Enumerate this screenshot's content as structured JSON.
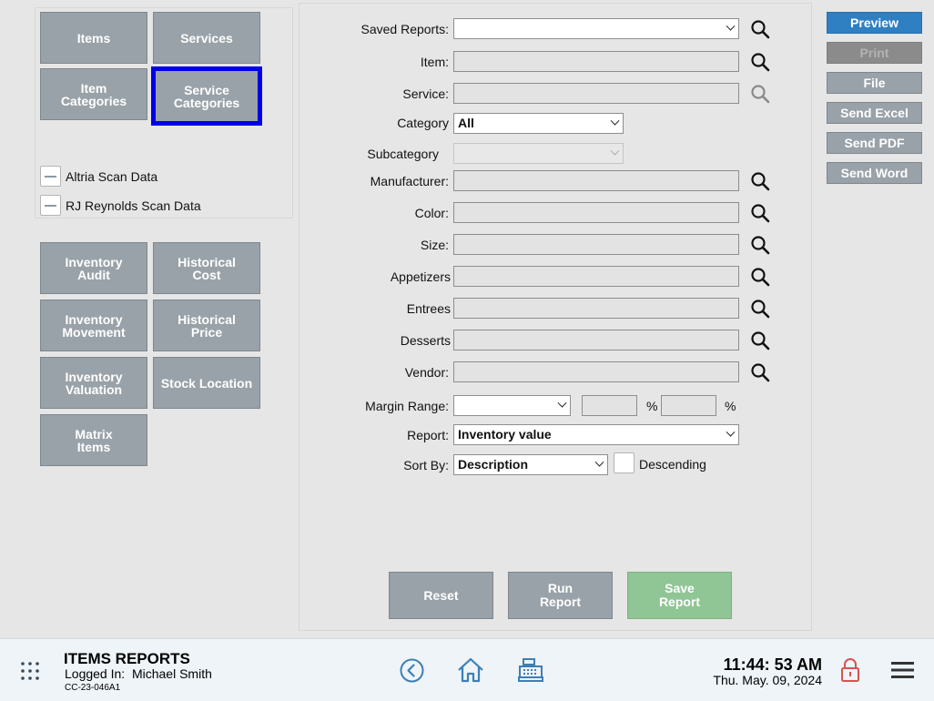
{
  "left_panel": {
    "top_tiles": [
      {
        "label": "Items"
      },
      {
        "label": "Services"
      },
      {
        "label": "Item\nCategories"
      },
      {
        "label": "Service\nCategories",
        "selected": true
      }
    ],
    "scan_options": [
      {
        "label": "Altria Scan Data",
        "checked": false
      },
      {
        "label": "RJ Reynolds Scan Data",
        "checked": false
      }
    ],
    "report_tiles": [
      {
        "label": "Inventory\nAudit"
      },
      {
        "label": "Historical\nCost"
      },
      {
        "label": "Inventory\nMovement"
      },
      {
        "label": "Historical\nPrice"
      },
      {
        "label": "Inventory\nValuation"
      },
      {
        "label": "Stock Location"
      },
      {
        "label": "Matrix\nItems"
      }
    ]
  },
  "form": {
    "saved_reports": {
      "label": "Saved Reports:",
      "value": ""
    },
    "item": {
      "label": "Item:",
      "value": ""
    },
    "service": {
      "label": "Service:",
      "value": ""
    },
    "category": {
      "label": "Category",
      "value": "All"
    },
    "subcategory": {
      "label": "Subcategory",
      "value": ""
    },
    "manufacturer": {
      "label": "Manufacturer:",
      "value": ""
    },
    "color": {
      "label": "Color:",
      "value": ""
    },
    "size": {
      "label": "Size:",
      "value": ""
    },
    "appetizers": {
      "label": "Appetizers",
      "value": ""
    },
    "entrees": {
      "label": "Entrees",
      "value": ""
    },
    "desserts": {
      "label": "Desserts",
      "value": ""
    },
    "vendor": {
      "label": "Vendor:",
      "value": ""
    },
    "margin_range": {
      "label": "Margin Range:",
      "value": "",
      "min": "",
      "max": "",
      "pct_symbol": "%"
    },
    "report": {
      "label": "Report:",
      "value": "Inventory value"
    },
    "sort_by": {
      "label": "Sort By:",
      "value": "Description"
    },
    "descending": {
      "label": "Descending",
      "checked": false
    },
    "buttons": {
      "reset": "Reset",
      "run": "Run\nReport",
      "save": "Save\nReport"
    }
  },
  "right_buttons": {
    "preview": "Preview",
    "print": "Print",
    "file": "File",
    "send_excel": "Send Excel",
    "send_pdf": "Send PDF",
    "send_word": "Send Word"
  },
  "footer": {
    "title": "ITEMS REPORTS",
    "logged_in_label": "Logged In:",
    "user": "Michael Smith",
    "device_code": "CC-23-046A1",
    "time": "11:44: 53 AM",
    "date": "Thu. May. 09, 2024"
  },
  "colors": {
    "tile": "#99a2a8",
    "selected_border": "#0000e8",
    "primary": "#2f80c2",
    "save_green": "#90c595",
    "footer_bg": "#eef4f8",
    "footer_icon": "#3d7fb6",
    "lock_icon": "#d9534f"
  },
  "icons": {
    "search": "search-icon",
    "menu_grid": "grid-dots-icon",
    "back": "back-arrow-icon",
    "home": "home-icon",
    "register": "cash-register-icon",
    "lock": "lock-icon",
    "hamburger": "hamburger-menu-icon"
  }
}
